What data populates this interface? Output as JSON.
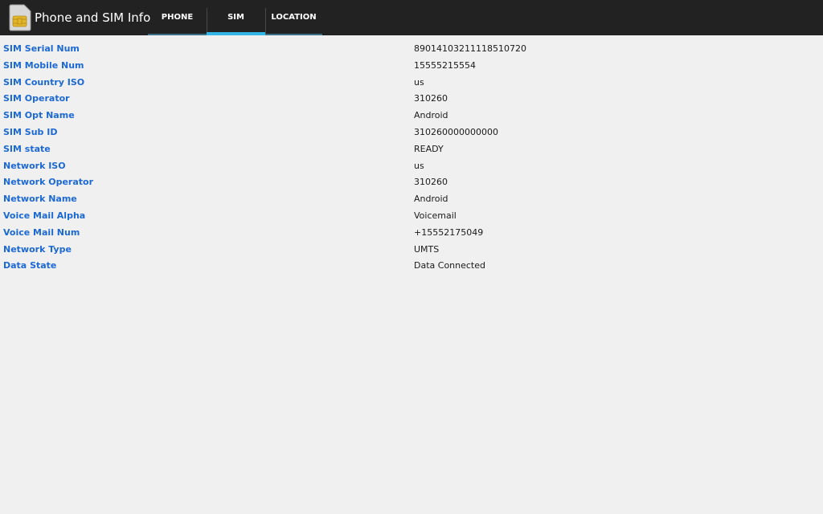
{
  "app": {
    "title": "Phone and SIM Info",
    "icon": "sim-card-icon"
  },
  "tabs": [
    {
      "label": "PHONE",
      "selected": false
    },
    {
      "label": "SIM",
      "selected": true
    },
    {
      "label": "LOCATION",
      "selected": false
    }
  ],
  "colors": {
    "action_bar": "#222222",
    "tab_indicator": "#33b5e5",
    "label": "#1c69d4",
    "background": "#f0f0f0"
  },
  "rows": [
    {
      "label": "SIM Serial Num",
      "value": "89014103211118510720"
    },
    {
      "label": "SIM Mobile Num",
      "value": "15555215554"
    },
    {
      "label": "SIM Country ISO",
      "value": "us"
    },
    {
      "label": "SIM Operator",
      "value": "310260"
    },
    {
      "label": "SIM Opt Name",
      "value": "Android"
    },
    {
      "label": "SIM Sub ID",
      "value": "310260000000000"
    },
    {
      "label": "SIM state",
      "value": "READY"
    },
    {
      "label": "Network ISO",
      "value": "us"
    },
    {
      "label": "Network Operator",
      "value": "310260"
    },
    {
      "label": "Network Name",
      "value": "Android"
    },
    {
      "label": "Voice Mail Alpha",
      "value": "Voicemail"
    },
    {
      "label": "Voice Mail Num",
      "value": "+15552175049"
    },
    {
      "label": "Network Type",
      "value": "UMTS"
    },
    {
      "label": "Data State",
      "value": "Data Connected"
    }
  ]
}
